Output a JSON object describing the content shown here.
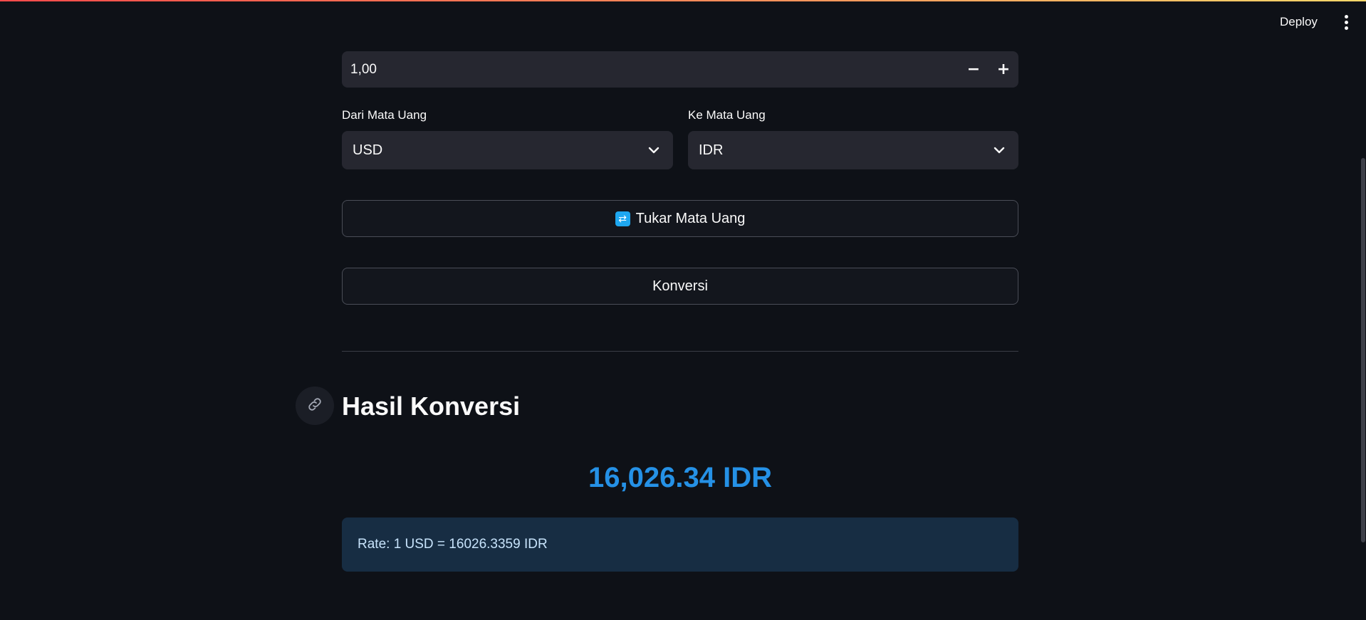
{
  "header": {
    "deploy_label": "Deploy",
    "menu_icon": "vertical-dots-icon"
  },
  "amount_input": {
    "value": "1,00",
    "decrement_label": "−",
    "increment_label": "+"
  },
  "from_currency": {
    "label": "Dari Mata Uang",
    "selected": "USD"
  },
  "to_currency": {
    "label": "Ke Mata Uang",
    "selected": "IDR"
  },
  "swap_button": {
    "icon": "swap-arrows-icon",
    "icon_glyph": "⇄",
    "label": "Tukar Mata Uang"
  },
  "convert_button": {
    "label": "Konversi"
  },
  "result_section": {
    "anchor_icon": "link-icon",
    "title": "Hasil Konversi",
    "converted_value": "16,026.34 IDR",
    "rate_text": "Rate: 1 USD = 16026.3359 IDR"
  },
  "colors": {
    "background": "#0e1117",
    "input_bg": "#262730",
    "result_accent": "#2591e6",
    "info_box_bg": "#172d43",
    "swap_icon_bg": "#1ea7f0"
  }
}
